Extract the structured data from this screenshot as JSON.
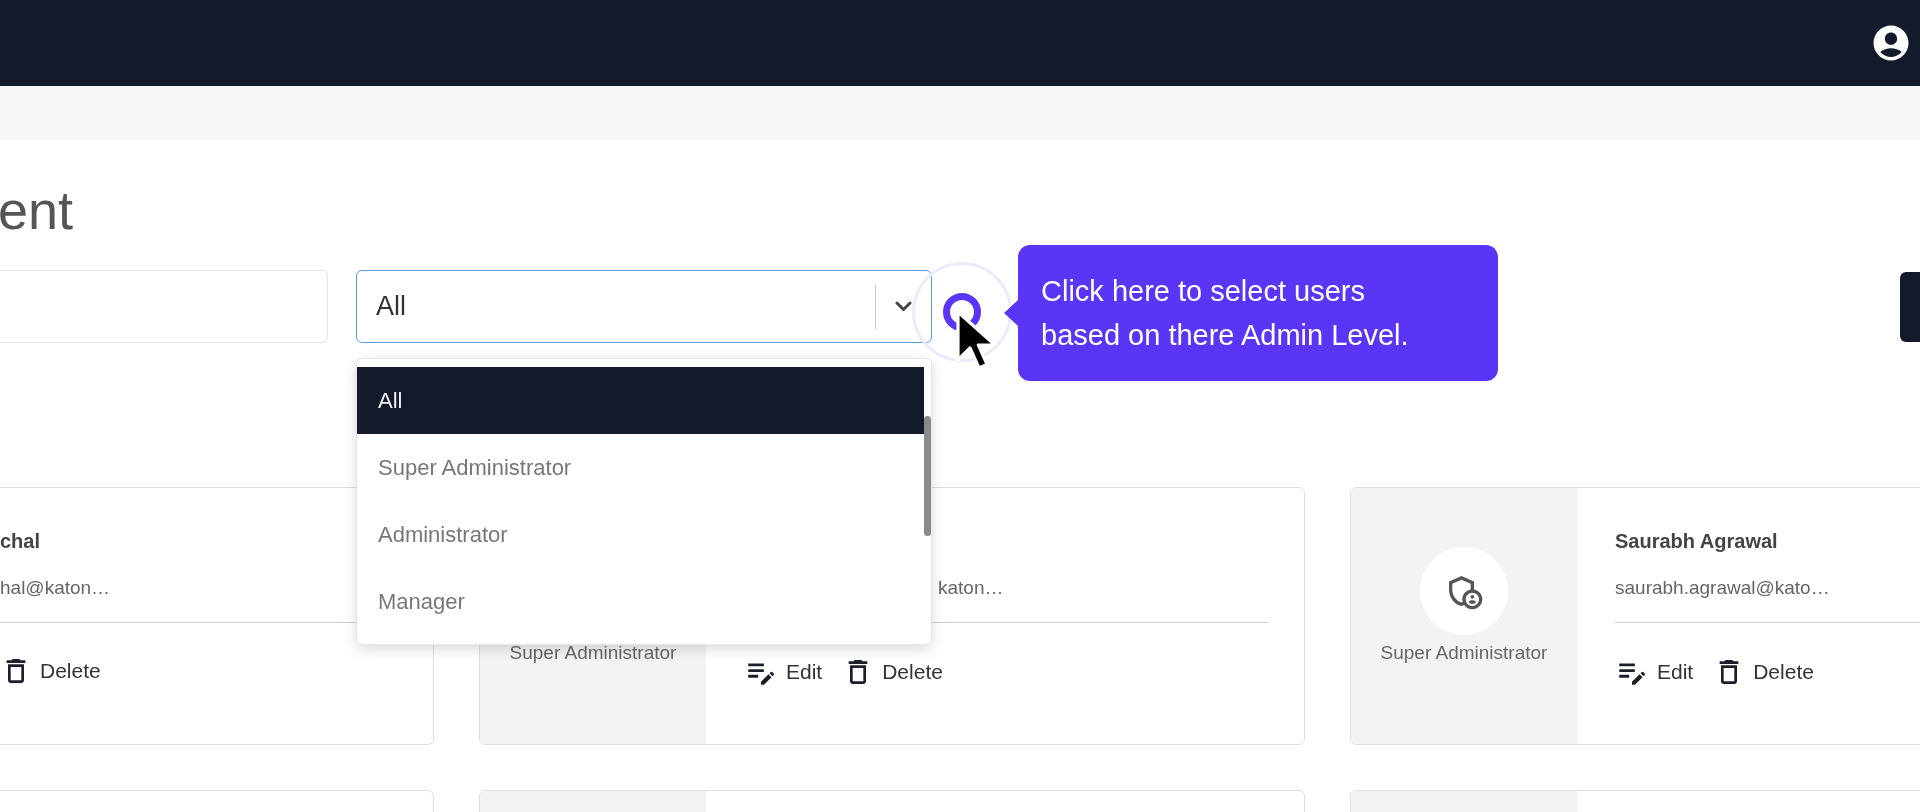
{
  "page_title": "ent",
  "filter": {
    "value": "All",
    "expanded": true
  },
  "role_options": [
    {
      "label": "All",
      "selected": true
    },
    {
      "label": "Super Administrator",
      "selected": false
    },
    {
      "label": "Administrator",
      "selected": false
    },
    {
      "label": "Manager",
      "selected": false
    }
  ],
  "tour_tooltip": {
    "text": "Click here to select users based on there Admin Level."
  },
  "user_cards": [
    {
      "name": "chal",
      "email": "hal@katon…",
      "actions": [
        {
          "kind": "delete",
          "label": "Delete"
        }
      ]
    },
    {
      "email": "katon…",
      "role": "Super Administrator",
      "actions": [
        {
          "kind": "edit",
          "label": "Edit"
        },
        {
          "kind": "delete",
          "label": "Delete"
        }
      ]
    },
    {
      "name": "Saurabh Agrawal",
      "email": "saurabh.agrawal@kato…",
      "role": "Super Administrator",
      "show_badge": true,
      "actions": [
        {
          "kind": "edit",
          "label": "Edit"
        },
        {
          "kind": "delete",
          "label": "Delete"
        }
      ]
    }
  ]
}
